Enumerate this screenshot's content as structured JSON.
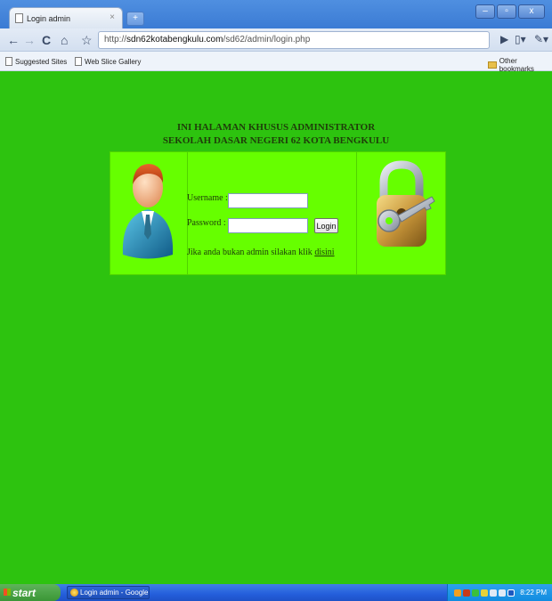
{
  "browser": {
    "tab_title": "Login admin",
    "tab_close": "×",
    "new_tab": "+",
    "url_prefix": "http://",
    "url_host": "sdn62kotabengkulu.com",
    "url_path": "/sd62/admin/login.php",
    "bookmarks": [
      "Suggested Sites",
      "Web Slice Gallery"
    ],
    "other_bookmarks": "Other bookmarks"
  },
  "page": {
    "heading_line1": "INI HALAMAN KHUSUS ADMINISTRATOR",
    "heading_line2": "SEKOLAH DASAR NEGERI 62 KOTA BENGKULU",
    "username_label": "Username :",
    "password_label": "Password :",
    "username_value": "",
    "password_value": "",
    "login_button": "Login",
    "note_text": "Jika anda bukan admin silakan klik ",
    "note_link": "disini"
  },
  "taskbar": {
    "start_label": "start",
    "task_label": "Login admin - Google ...",
    "clock": "8:22 PM"
  },
  "colors": {
    "page_bg": "#2dc30f",
    "table_bg": "#66ff00"
  }
}
